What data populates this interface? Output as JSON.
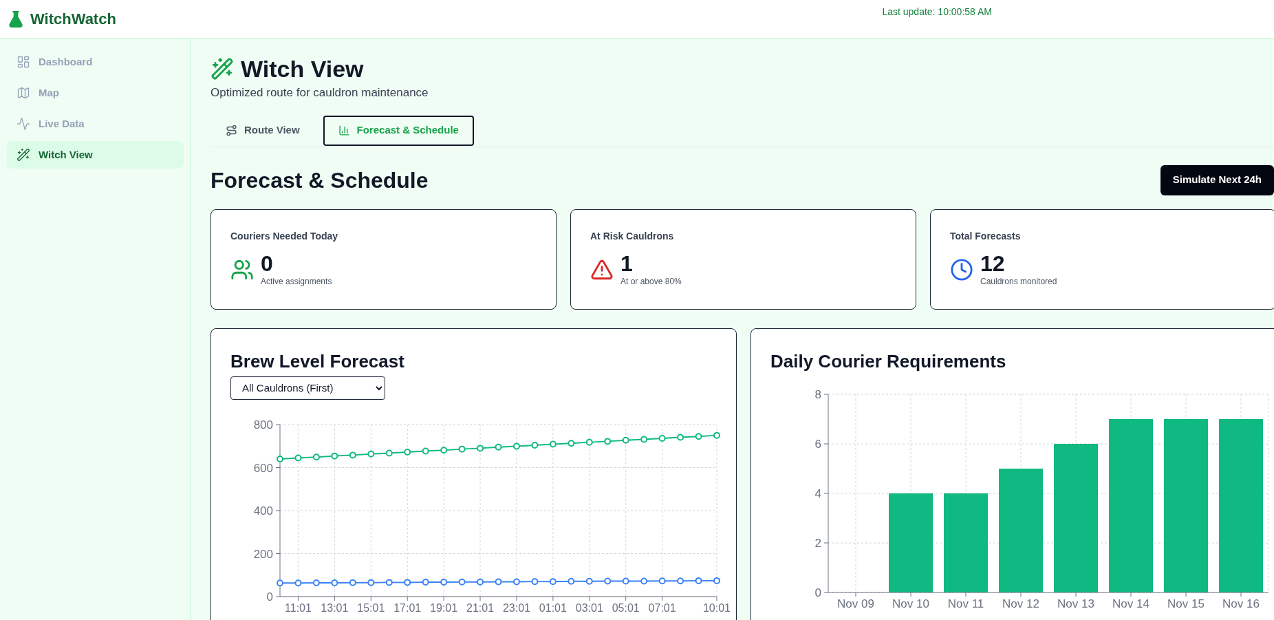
{
  "app": {
    "name": "WitchWatch",
    "last_update": "Last update: 10:00:58 AM"
  },
  "sidebar": {
    "items": [
      {
        "kind": "dashboard",
        "label": "Dashboard",
        "selected": false
      },
      {
        "kind": "map",
        "label": "Map",
        "selected": false
      },
      {
        "kind": "live",
        "label": "Live Data",
        "selected": false
      },
      {
        "kind": "wand",
        "label": "Witch View",
        "selected": true
      }
    ]
  },
  "page": {
    "title": "Witch View",
    "subtitle": "Optimized route for cauldron maintenance"
  },
  "tabs": [
    {
      "kind": "route",
      "label": "Route View",
      "selected": false
    },
    {
      "kind": "chart",
      "label": "Forecast & Schedule",
      "selected": true
    }
  ],
  "section": {
    "title": "Forecast & Schedule",
    "action": "Simulate Next 24h"
  },
  "stats": [
    {
      "kind": "people",
      "label": "Couriers Needed Today",
      "value": "0",
      "caption": "Active assignments",
      "color": "#16a34a"
    },
    {
      "kind": "warning",
      "label": "At Risk Cauldrons",
      "value": "1",
      "caption": "At or above 80%",
      "color": "#dc2626"
    },
    {
      "kind": "clock",
      "label": "Total Forecasts",
      "value": "12",
      "caption": "Cauldrons monitored",
      "color": "#2563eb"
    }
  ],
  "brew_forecast": {
    "title": "Brew Level Forecast",
    "selector": "All Cauldrons (First)",
    "chart_data": {
      "type": "line",
      "grid": true,
      "categories": [
        null,
        "11:01",
        null,
        "13:01",
        null,
        "15:01",
        null,
        "17:01",
        null,
        "19:01",
        null,
        "21:01",
        null,
        "23:01",
        null,
        "01:01",
        null,
        "03:01",
        null,
        "05:01",
        null,
        "07:01",
        null,
        null,
        "10:01"
      ],
      "series": [
        {
          "color": "#10b981",
          "marker": "circle",
          "values": [
            640,
            645,
            649,
            654,
            658,
            663,
            667,
            672,
            677,
            681,
            686,
            690,
            695,
            699,
            704,
            709,
            713,
            718,
            722,
            727,
            731,
            736,
            741,
            745,
            750
          ]
        },
        {
          "color": "#3b82f6",
          "marker": "circle",
          "values": [
            63,
            63,
            64,
            64,
            65,
            65,
            66,
            66,
            67,
            67,
            68,
            68,
            69,
            69,
            70,
            70,
            71,
            71,
            72,
            72,
            72,
            73,
            73,
            74,
            74
          ]
        }
      ],
      "ylim": [
        0,
        800
      ],
      "yticks": [
        0,
        200,
        400,
        600,
        800
      ]
    }
  },
  "courier_requirements": {
    "title": "Daily Courier Requirements",
    "chart_data": {
      "type": "bar",
      "grid": true,
      "categories": [
        "Nov 09",
        "Nov 10",
        "Nov 11",
        "Nov 12",
        "Nov 13",
        "Nov 14",
        "Nov 15",
        "Nov 16"
      ],
      "series": [
        {
          "color": "#10b981",
          "values": [
            0,
            4,
            4,
            5,
            6,
            7,
            7,
            7
          ]
        }
      ],
      "ylim": [
        0,
        8
      ],
      "yticks": [
        0,
        2,
        4,
        6,
        8
      ]
    }
  }
}
